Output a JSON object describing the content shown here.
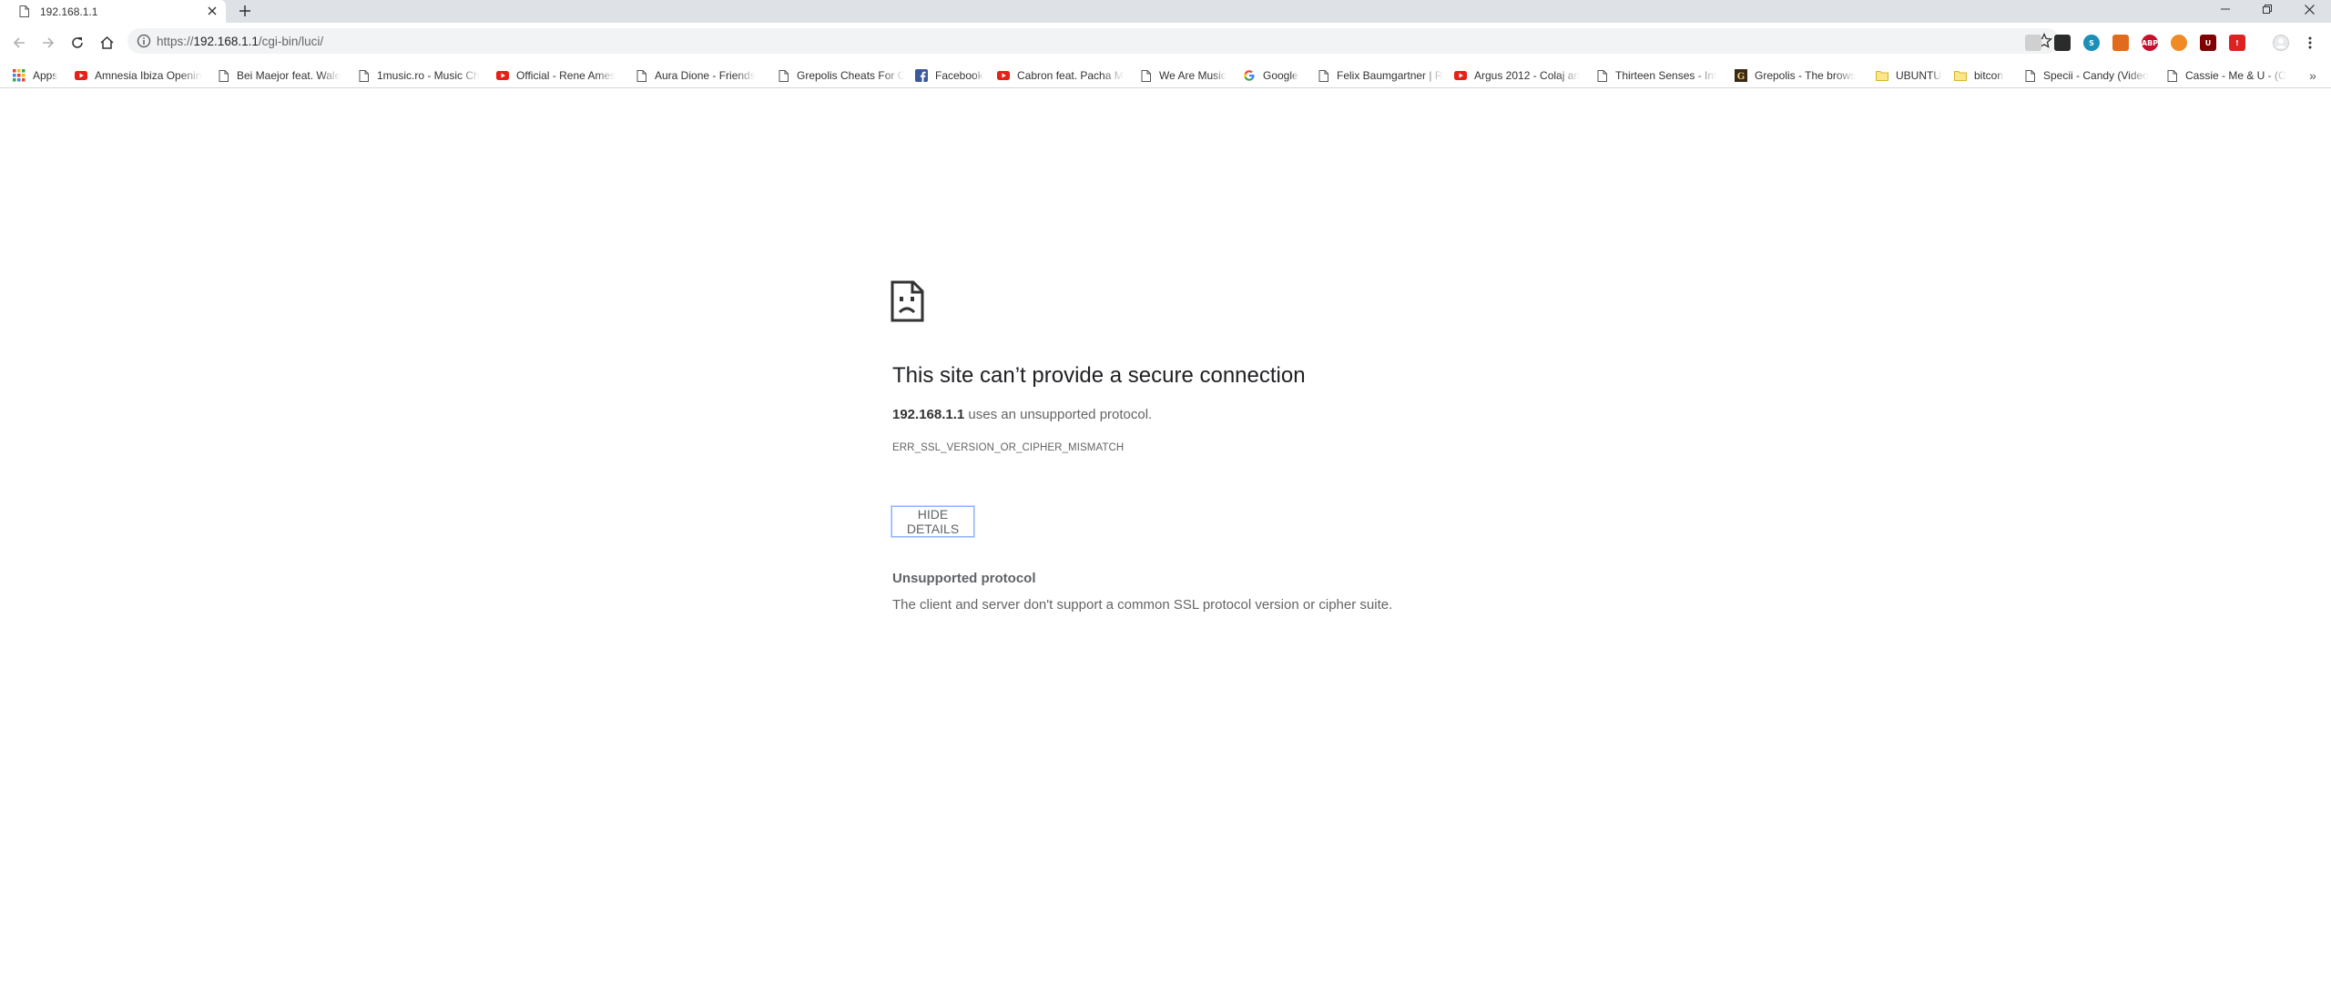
{
  "tab": {
    "title": "192.168.1.1"
  },
  "toolbar": {
    "url_scheme": "https://",
    "url_host": "192.168.1.1",
    "url_path": "/cgi-bin/luci/"
  },
  "extensions": [
    {
      "name": "acrobat-extension-icon",
      "color": "#d0d0d0",
      "label": ""
    },
    {
      "name": "devtools-extension-icon",
      "color": "#2b2b2b",
      "label": ""
    },
    {
      "name": "skype-extension-icon",
      "color": "#1a8fb8",
      "label": "S"
    },
    {
      "name": "honey-extension-icon",
      "color": "#e06b1d",
      "label": ""
    },
    {
      "name": "adblock-plus-extension-icon",
      "color": "#c8102e",
      "label": "ABP"
    },
    {
      "name": "vpn-extension-icon",
      "color": "#f08a24",
      "label": ""
    },
    {
      "name": "ublock-extension-icon",
      "color": "#800000",
      "label": "U"
    },
    {
      "name": "lastpass-extension-icon",
      "color": "#d22",
      "label": "!"
    }
  ],
  "bookmarks": [
    {
      "label": "Apps",
      "icon": "apps-grid-icon"
    },
    {
      "label": "Amnesia Ibiza Opening",
      "icon": "youtube-icon"
    },
    {
      "label": "Bei Maejor feat. Wale",
      "icon": "page-icon"
    },
    {
      "label": "1music.ro - Music Ch",
      "icon": "page-icon"
    },
    {
      "label": "Official - Rene Ames",
      "icon": "youtube-icon"
    },
    {
      "label": "Aura Dione - Friends",
      "icon": "page-icon"
    },
    {
      "label": "Grepolis Cheats For C",
      "icon": "page-icon"
    },
    {
      "label": "Facebook",
      "icon": "facebook-icon"
    },
    {
      "label": "Cabron feat. Pacha M",
      "icon": "youtube-icon"
    },
    {
      "label": "We Are Music",
      "icon": "page-icon"
    },
    {
      "label": "Google",
      "icon": "google-icon"
    },
    {
      "label": "Felix Baumgartner | R",
      "icon": "page-icon"
    },
    {
      "label": "Argus 2012 - Colaj an",
      "icon": "youtube-icon"
    },
    {
      "label": "Thirteen Senses - Int",
      "icon": "page-icon"
    },
    {
      "label": "Grepolis - The brows",
      "icon": "grepolis-icon"
    },
    {
      "label": "UBUNTU",
      "icon": "folder-icon"
    },
    {
      "label": "bitcon",
      "icon": "folder-icon"
    },
    {
      "label": "Specii - Candy (Video",
      "icon": "page-icon"
    },
    {
      "label": "Cassie - Me & U - (O",
      "icon": "page-icon"
    }
  ],
  "bookmarks_overflow": "»",
  "error": {
    "title": "This site can’t provide a secure connection",
    "host": "192.168.1.1",
    "desc_suffix": " uses an unsupported protocol.",
    "code": "ERR_SSL_VERSION_OR_CIPHER_MISMATCH",
    "details_button": "HIDE DETAILS",
    "details_title": "Unsupported protocol",
    "details_body": "The client and server don't support a common SSL protocol version or cipher suite."
  }
}
